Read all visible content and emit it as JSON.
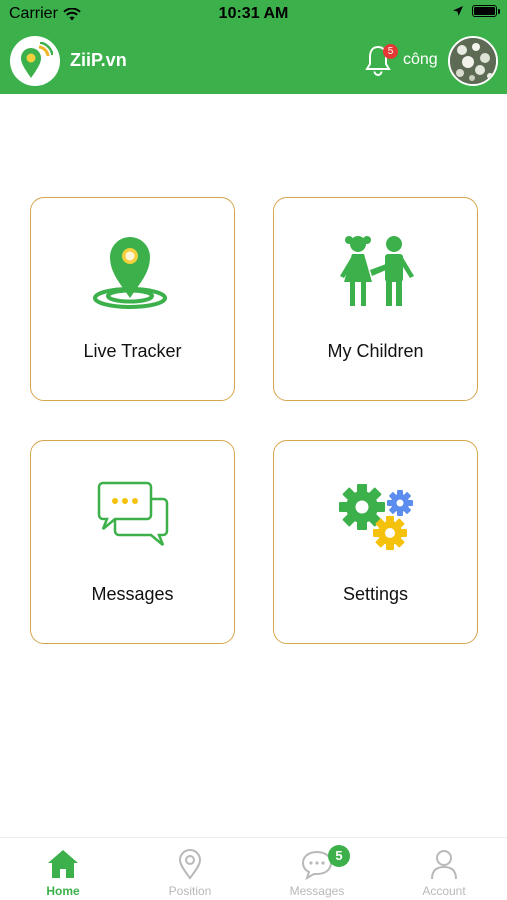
{
  "status_bar": {
    "carrier": "Carrier",
    "time": "10:31 AM"
  },
  "header": {
    "brand": "ZiiP.vn",
    "notification_count": "5",
    "username": "công",
    "background_color": "#3cb04a"
  },
  "tiles": [
    {
      "label": "Live Tracker",
      "icon": "location-tracker-icon"
    },
    {
      "label": "My Children",
      "icon": "children-icon"
    },
    {
      "label": "Messages",
      "icon": "chat-bubbles-icon"
    },
    {
      "label": "Settings",
      "icon": "gears-icon"
    }
  ],
  "tile_border_color": "#d6a64c",
  "bottom_nav": {
    "items": [
      {
        "label": "Home",
        "icon": "home-icon",
        "active": true
      },
      {
        "label": "Position",
        "icon": "location-pin-icon",
        "active": false
      },
      {
        "label": "Messages",
        "icon": "chat-icon",
        "active": false,
        "badge": "5"
      },
      {
        "label": "Account",
        "icon": "user-icon",
        "active": false
      }
    ]
  }
}
